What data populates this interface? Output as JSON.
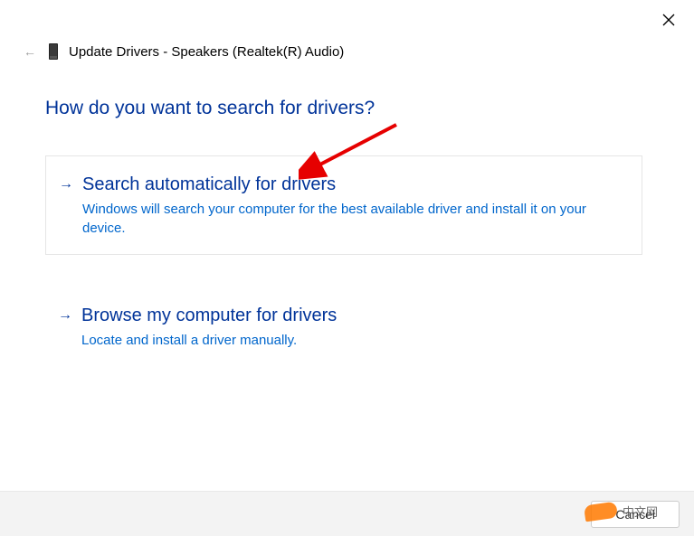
{
  "header": {
    "title": "Update Drivers - Speakers (Realtek(R) Audio)"
  },
  "question": "How do you want to search for drivers?",
  "options": {
    "auto": {
      "title": "Search automatically for drivers",
      "description": "Windows will search your computer for the best available driver and install it on your device."
    },
    "browse": {
      "title": "Browse my computer for drivers",
      "description": "Locate and install a driver manually."
    }
  },
  "buttons": {
    "cancel": "Cancel"
  },
  "watermark": "中文网"
}
